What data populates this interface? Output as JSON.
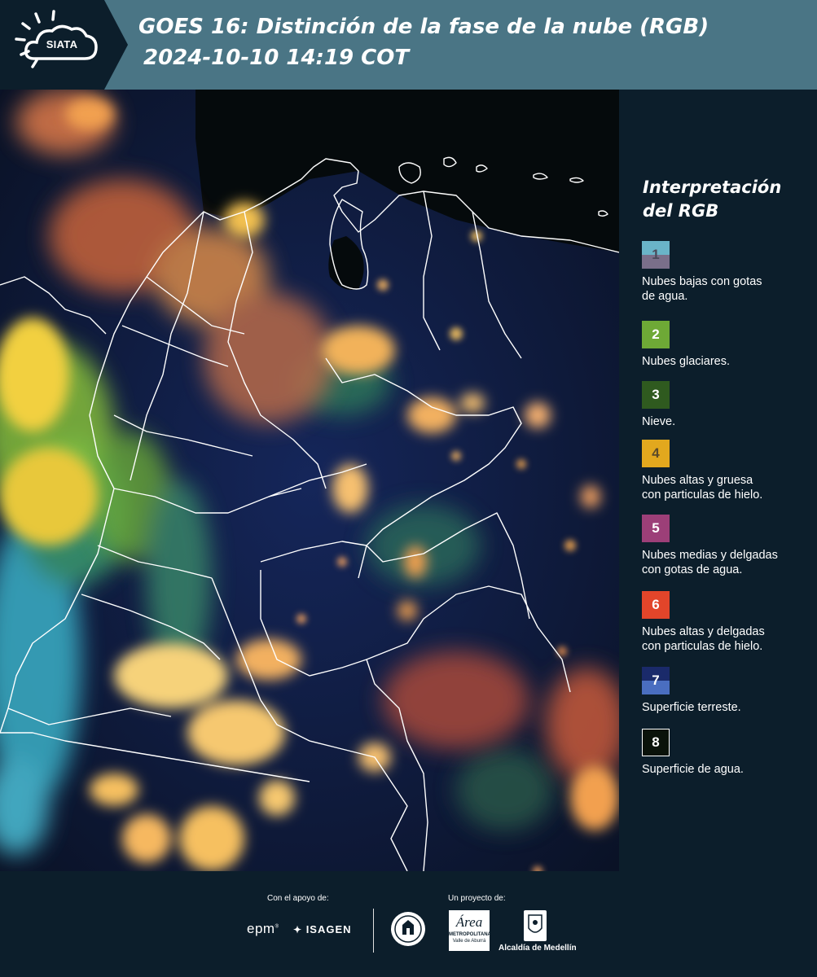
{
  "header": {
    "logo_text": "SIATA",
    "title_line1": "GOES 16: Distinción de la fase de la nube (RGB)",
    "title_line2": "2024-10-10 14:19 COT"
  },
  "legend": {
    "title_line1": "Interpretación",
    "title_line2": "del RGB",
    "items": [
      {
        "number": "1",
        "label_line1": "Nubes bajas con gotas",
        "label_line2": "de agua.",
        "color_top": "#6ab4c8",
        "color_bottom": "#7a6f8a",
        "number_color": "#4a4a5a"
      },
      {
        "number": "2",
        "label_line1": "Nubes glaciares.",
        "label_line2": "",
        "color_top": "#6ea936",
        "color_bottom": "#6ea936",
        "number_color": "#ffffff"
      },
      {
        "number": "3",
        "label_line1": "Nieve.",
        "label_line2": "",
        "color_top": "#2f5a1f",
        "color_bottom": "#2f5a1f",
        "number_color": "#ffffff"
      },
      {
        "number": "4",
        "label_line1": "Nubes altas y gruesa",
        "label_line2": "con particulas de hielo.",
        "color_top": "#e2a81e",
        "color_bottom": "#e2a81e",
        "number_color": "#5a4a2a"
      },
      {
        "number": "5",
        "label_line1": "Nubes medias y delgadas",
        "label_line2": "con gotas de agua.",
        "color_top": "#9c3f78",
        "color_bottom": "#9c3f78",
        "number_color": "#ffffff"
      },
      {
        "number": "6",
        "label_line1": "Nubes altas y delgadas",
        "label_line2": "con particulas de hielo.",
        "color_top": "#e2452a",
        "color_bottom": "#e2452a",
        "number_color": "#ffffff"
      },
      {
        "number": "7",
        "label_line1": "Superficie terreste.",
        "label_line2": "",
        "color_top": "#1a2a6a",
        "color_bottom": "#4a6ec0",
        "number_color": "#ffffff"
      },
      {
        "number": "8",
        "label_line1": "Superficie de agua.",
        "label_line2": "",
        "color_top": "#0a120a",
        "color_bottom": "#0a120a",
        "number_color": "#ffffff"
      }
    ]
  },
  "footer": {
    "support_label": "Con el apoyo de:",
    "project_label": "Un proyecto de:",
    "sponsor_epm": "epm",
    "sponsor_isagen": "ISAGEN",
    "sponsor_area_line1": "Área",
    "sponsor_area_line2": "METROPOLITANA",
    "sponsor_area_line3": "Valle de Aburrá",
    "sponsor_alcaldia": "Alcaldía de Medellín"
  }
}
